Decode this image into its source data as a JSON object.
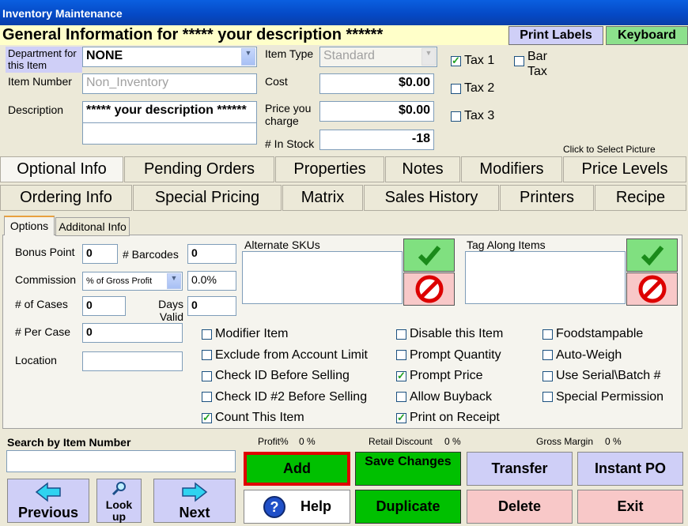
{
  "window": {
    "title": "Inventory Maintenance"
  },
  "header": {
    "title": "General Information for ***** your description ******",
    "print_labels": "Print Labels",
    "keyboard": "Keyboard"
  },
  "form": {
    "department_label": "Department for this Item",
    "department_value": "NONE",
    "item_number_label": "Item Number",
    "item_number_value": "Non_Inventory",
    "description_label": "Description",
    "description_value": "***** your description ******",
    "item_type_label": "Item Type",
    "item_type_value": "Standard",
    "cost_label": "Cost",
    "cost_value": "$0.00",
    "price_label": "Price you charge",
    "price_value": "$0.00",
    "stock_label": "# In Stock",
    "stock_value": "-18",
    "tax1": {
      "label": "Tax 1",
      "checked": true
    },
    "tax2": {
      "label": "Tax 2",
      "checked": false
    },
    "tax3": {
      "label": "Tax 3",
      "checked": false
    },
    "bar_tax": {
      "label": "Bar Tax",
      "checked": false
    },
    "picture_hint": "Click to Select Picture"
  },
  "tabs_row1": [
    "Optional Info",
    "Pending Orders",
    "Properties",
    "Notes",
    "Modifiers",
    "Price Levels"
  ],
  "tabs_row2": [
    "Ordering Info",
    "Special Pricing",
    "Matrix",
    "Sales History",
    "Printers",
    "Recipe"
  ],
  "subtabs": [
    "Options",
    "Additonal Info"
  ],
  "options": {
    "bonus_point_label": "Bonus Point",
    "bonus_point_value": "0",
    "barcodes_label": "# Barcodes",
    "barcodes_value": "0",
    "commission_label": "Commission",
    "commission_type": "% of Gross Profit",
    "commission_value": "0.0%",
    "cases_label": "# of Cases",
    "cases_value": "0",
    "days_valid_label": "Days Valid",
    "days_valid_value": "0",
    "per_case_label": "# Per Case",
    "per_case_value": "0",
    "location_label": "Location",
    "location_value": "",
    "alt_skus_label": "Alternate SKUs",
    "tag_along_label": "Tag Along Items"
  },
  "checkboxes": {
    "col1": [
      {
        "label": "Modifier Item",
        "checked": false
      },
      {
        "label": "Exclude from Account Limit",
        "checked": false
      },
      {
        "label": "Check ID Before Selling",
        "checked": false
      },
      {
        "label": "Check ID #2 Before Selling",
        "checked": false
      },
      {
        "label": "Count This Item",
        "checked": true
      }
    ],
    "col2": [
      {
        "label": "Disable this Item",
        "checked": false
      },
      {
        "label": "Prompt Quantity",
        "checked": false
      },
      {
        "label": "Prompt Price",
        "checked": true
      },
      {
        "label": "Allow Buyback",
        "checked": false
      },
      {
        "label": "Print on Receipt",
        "checked": true
      }
    ],
    "col3": [
      {
        "label": "Foodstampable",
        "checked": false
      },
      {
        "label": "Auto-Weigh",
        "checked": false
      },
      {
        "label": "Use Serial\\Batch #",
        "checked": false
      },
      {
        "label": "Special Permission",
        "checked": false
      }
    ]
  },
  "bottom": {
    "search_label": "Search by Item Number",
    "search_value": "",
    "profit_label": "Profit%",
    "profit_value": "0 %",
    "retail_discount_label": "Retail Discount",
    "retail_discount_value": "0 %",
    "gross_margin_label": "Gross Margin",
    "gross_margin_value": "0 %",
    "previous": "Previous",
    "lookup": "Look up",
    "next": "Next",
    "add": "Add",
    "save_changes": "Save Changes",
    "transfer": "Transfer",
    "instant_po": "Instant PO",
    "help": "Help",
    "duplicate": "Duplicate",
    "delete": "Delete",
    "exit": "Exit"
  },
  "colors": {
    "title_bar": "#0548c4",
    "header_bg": "#ffffc9",
    "green": "#00c000",
    "lavender": "#cfcff7",
    "pink": "#f8c8c8",
    "highlight_red": "#e00000"
  }
}
